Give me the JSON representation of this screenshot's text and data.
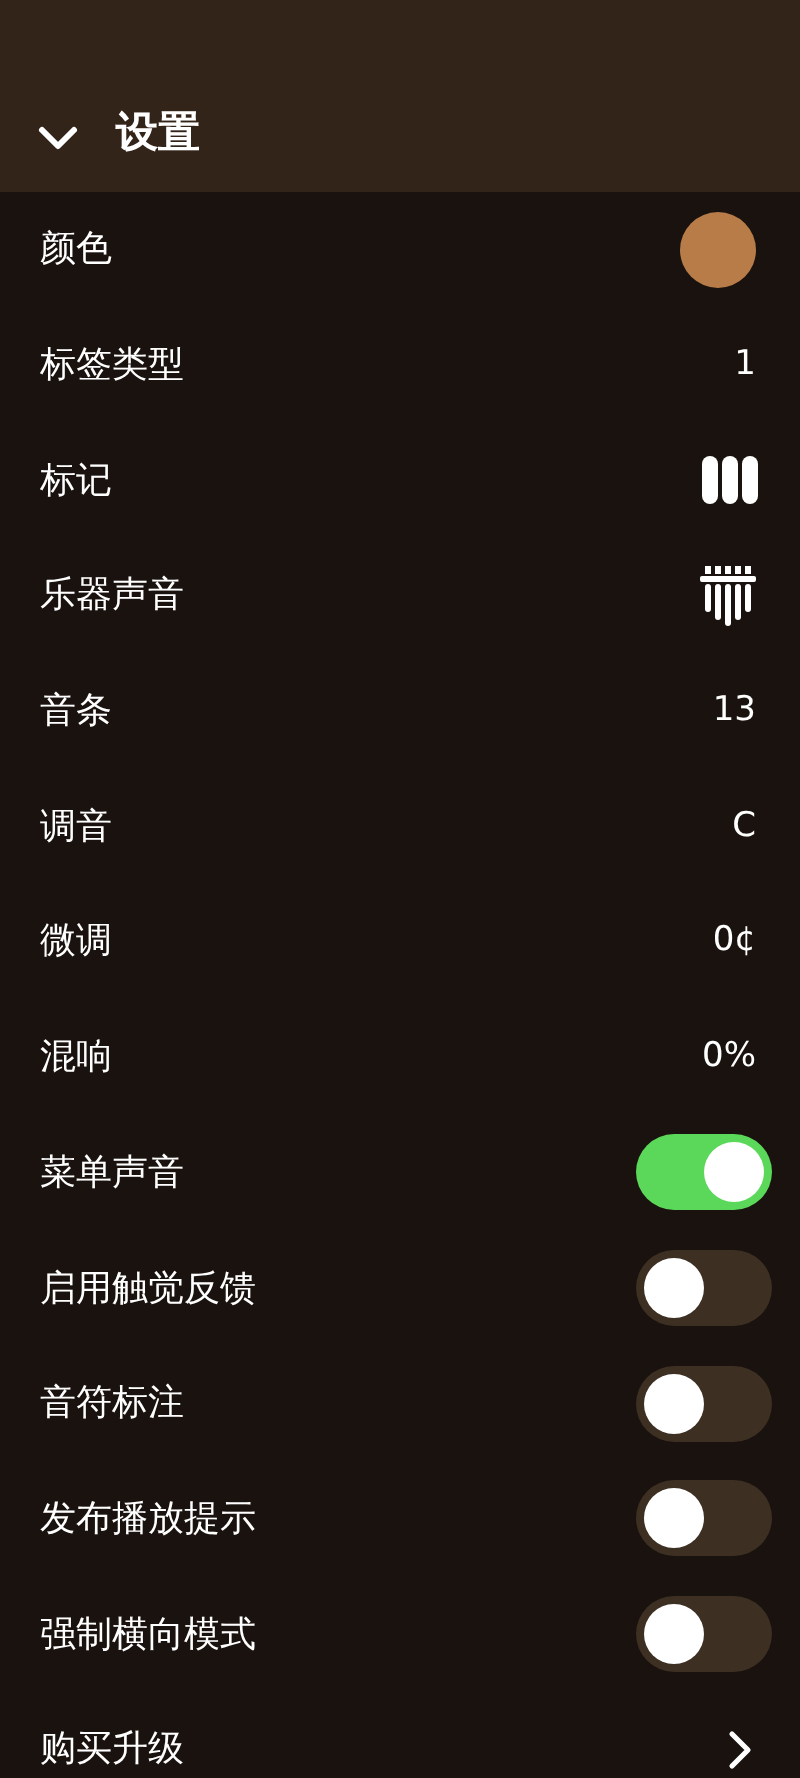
{
  "header": {
    "title": "设置",
    "expanded": true
  },
  "rows": [
    {
      "kind": "color",
      "label": "颜色",
      "color": "#b77c47"
    },
    {
      "kind": "value",
      "label": "标签类型",
      "value": "1"
    },
    {
      "kind": "bars",
      "label": "标记"
    },
    {
      "kind": "instrument",
      "label": "乐器声音"
    },
    {
      "kind": "value",
      "label": "音条",
      "value": "13"
    },
    {
      "kind": "value",
      "label": "调音",
      "value": "C"
    },
    {
      "kind": "value",
      "label": "微调",
      "value": "0¢"
    },
    {
      "kind": "value",
      "label": "混响",
      "value": "0%"
    },
    {
      "kind": "toggle",
      "label": "菜单声音",
      "on": true
    },
    {
      "kind": "toggle",
      "label": "启用触觉反馈",
      "on": false
    },
    {
      "kind": "toggle",
      "label": "音符标注",
      "on": false
    },
    {
      "kind": "toggle",
      "label": "发布播放提示",
      "on": false
    },
    {
      "kind": "toggle",
      "label": "强制横向模式",
      "on": false
    },
    {
      "kind": "link",
      "label": "购买升级"
    }
  ]
}
